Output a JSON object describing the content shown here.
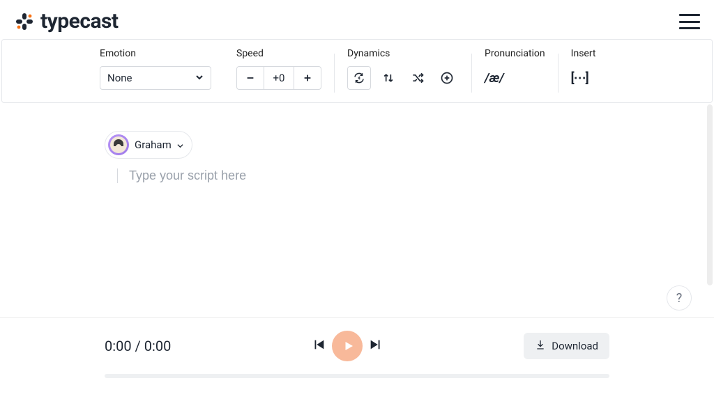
{
  "brand": {
    "name": "typecast"
  },
  "toolbar": {
    "emotion_label": "Emotion",
    "emotion_selected": "None",
    "speed_label": "Speed",
    "speed_value": "+0",
    "dynamics_label": "Dynamics",
    "pronunciation_label": "Pronunciation",
    "pronunciation_symbol": "/æ/",
    "insert_label": "Insert",
    "insert_symbol": "[⋯]"
  },
  "editor": {
    "voice_name": "Graham",
    "script_placeholder": "Type your script here"
  },
  "player": {
    "current_time": "0:00",
    "total_time": "0:00",
    "download_label": "Download"
  },
  "help": {
    "label": "?"
  }
}
